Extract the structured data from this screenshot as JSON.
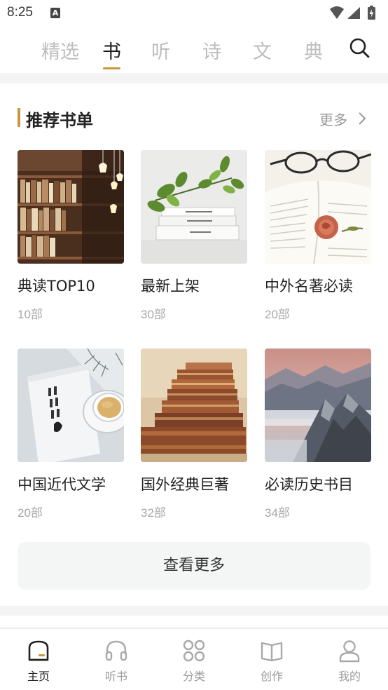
{
  "status_bar": {
    "time": "8:25",
    "indicator_glyph": "A"
  },
  "top_tabs": [
    {
      "label": "精选",
      "active": false
    },
    {
      "label": "书",
      "active": true
    },
    {
      "label": "听",
      "active": false
    },
    {
      "label": "诗",
      "active": false
    },
    {
      "label": "文",
      "active": false
    },
    {
      "label": "典",
      "active": false
    }
  ],
  "section": {
    "title": "推荐书单",
    "more_label": "更多",
    "view_more_label": "查看更多",
    "items": [
      {
        "name": "典读TOP10",
        "count": "10部",
        "cover": "bookshelf-library"
      },
      {
        "name": "最新上架",
        "count": "30部",
        "cover": "books-with-plant"
      },
      {
        "name": "中外名著必读",
        "count": "20部",
        "cover": "glasses-and-rose"
      },
      {
        "name": "中国近代文学",
        "count": "20部",
        "cover": "book-and-tea"
      },
      {
        "name": "国外经典巨著",
        "count": "32部",
        "cover": "antique-book-stack"
      },
      {
        "name": "必读历史书目",
        "count": "34部",
        "cover": "great-wall-mountains"
      }
    ]
  },
  "bottom_nav": [
    {
      "label": "主页",
      "icon": "home-icon",
      "active": true
    },
    {
      "label": "听书",
      "icon": "headphones-icon",
      "active": false
    },
    {
      "label": "分类",
      "icon": "category-icon",
      "active": false
    },
    {
      "label": "创作",
      "icon": "open-book-icon",
      "active": false
    },
    {
      "label": "我的",
      "icon": "user-icon",
      "active": false
    }
  ],
  "colors": {
    "accent": "#c8963e",
    "inactive_tab": "#bdbdbd",
    "muted_text": "#9a9a9a"
  }
}
